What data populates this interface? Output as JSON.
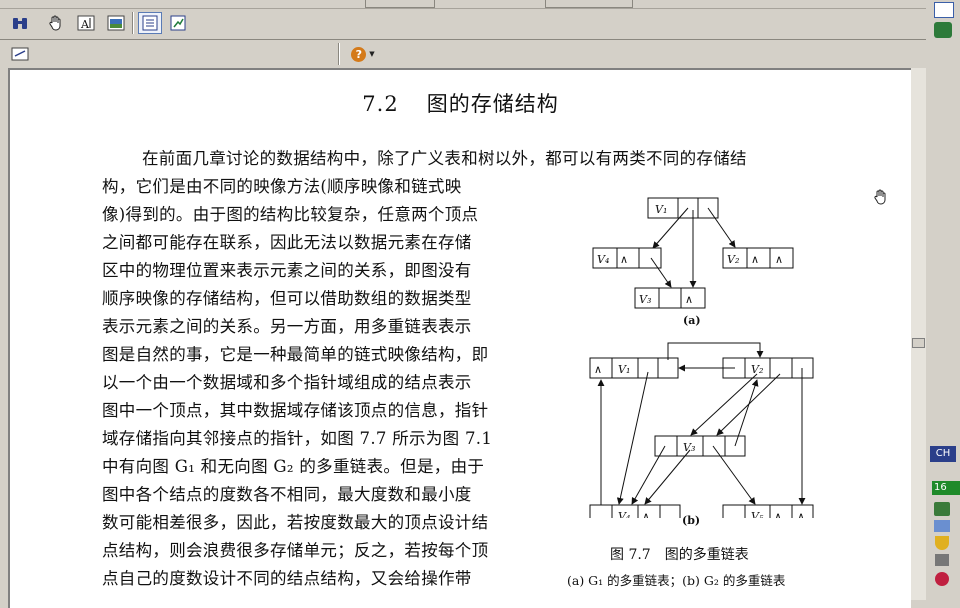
{
  "section": {
    "number": "7.2",
    "title": "图的存储结构"
  },
  "paragraphs": [
    "在前面几章讨论的数据结构中，除了广义表和树以外，都可以有两类不同的存储结",
    "构，它们是由不同的映像方法(顺序映像和链式映",
    "像)得到的。由于图的结构比较复杂，任意两个顶点",
    "之间都可能存在联系，因此无法以数据元素在存储",
    "区中的物理位置来表示元素之间的关系，即图没有",
    "顺序映像的存储结构，但可以借助数组的数据类型",
    "表示元素之间的关系。另一方面，用多重链表表示",
    "图是自然的事，它是一种最简单的链式映像结构，即",
    "以一个由一个数据域和多个指针域组成的结点表示",
    "图中一个顶点，其中数据域存储该顶点的信息，指针",
    "域存储指向其邻接点的指针，如图 7.7 所示为图 7.1",
    "中有向图 G₁ 和无向图 G₂ 的多重链表。但是，由于",
    "图中各个结点的度数各不相同，最大度数和最小度",
    "数可能相差很多，因此，若按度数最大的顶点设计结",
    "点结构，则会浪费很多存储单元；反之，若按每个顶",
    "点自己的度数设计不同的结点结构，又会给操作带"
  ],
  "figure": {
    "caption": "图 7.7　图的多重链表",
    "subcaption": "(a) G₁ 的多重链表；(b) G₂ 的多重链表",
    "label_a": "(a)",
    "label_b": "(b)",
    "nodes": {
      "v1": "V₁",
      "v2": "V₂",
      "v3": "V₃",
      "v4": "V₄",
      "v5": "V₅",
      "null": "∧"
    }
  },
  "toolbar": {
    "icons": [
      "binoculars-icon",
      "hand-tool-icon",
      "text-select-icon",
      "image-select-icon",
      "page-view-icon",
      "fit-view-icon"
    ],
    "help": "?"
  },
  "status": {
    "input_indicator": "CH",
    "number": "16"
  }
}
